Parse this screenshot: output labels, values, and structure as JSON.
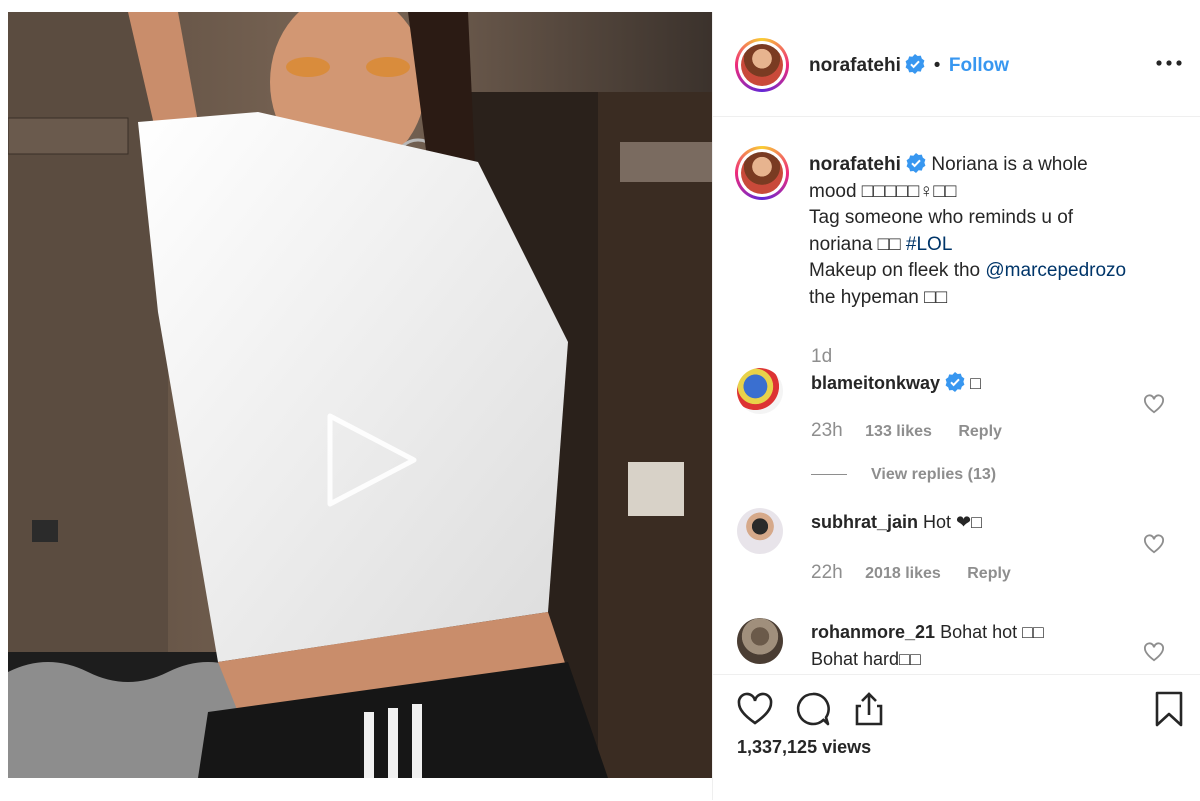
{
  "post": {
    "username": "norafatehi",
    "follow_label": "Follow",
    "separator": "•",
    "caption": {
      "line1": "Noriana is a whole",
      "line2": "mood □□□□□♀□□",
      "line3": "Tag someone who reminds u of",
      "line4_text": "noriana □□ ",
      "hashtag": "#LOL",
      "line5_text": "Makeup on fleek tho ",
      "mention": "@marcepedrozo",
      "line6": "the hypeman □□"
    },
    "timestamp": "1d",
    "views": "1,337,125 views"
  },
  "comments": [
    {
      "username": "blameitonkway",
      "text": "□",
      "age": "23h",
      "likes": "133 likes",
      "reply": "Reply",
      "view_replies": "View replies (13)"
    },
    {
      "username": "subhrat_jain",
      "text": "Hot ❤□",
      "age": "22h",
      "likes": "2018 likes",
      "reply": "Reply"
    },
    {
      "username": "rohanmore_21",
      "text": "Bohat hot □□",
      "text2": "Bohat hard□□"
    }
  ],
  "icons": {
    "verified": "verified-badge-icon",
    "more": "more-options-icon",
    "play": "play-icon",
    "like": "heart-icon",
    "comment": "comment-icon",
    "share": "share-icon",
    "save": "bookmark-icon"
  },
  "colors": {
    "link": "#003569",
    "follow": "#3897f0",
    "verified": "#3897f0",
    "muted": "#8e8e8e"
  }
}
